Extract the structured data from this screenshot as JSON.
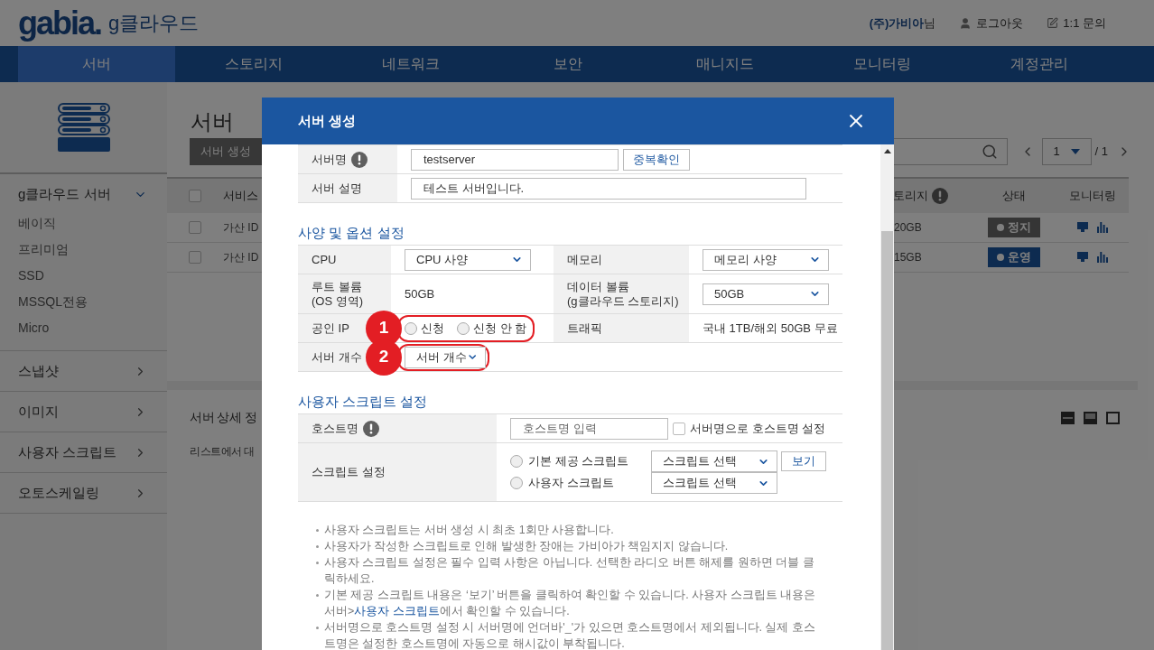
{
  "header": {
    "logo": "gabia.",
    "product": "g클라우드",
    "user": "**(주)가비아**님",
    "links": [
      {
        "kind": "logout",
        "label": "로그아웃"
      },
      {
        "kind": "inquiry",
        "label": "1:1 문의"
      }
    ]
  },
  "nav": [
    {
      "label": "서버",
      "selected": true
    },
    {
      "label": "스토리지",
      "selected": false
    },
    {
      "label": "네트워크",
      "selected": false
    },
    {
      "label": "보안",
      "selected": false
    },
    {
      "label": "매니지드",
      "selected": false
    },
    {
      "label": "모니터링",
      "selected": false
    },
    {
      "label": "계정관리",
      "selected": false
    }
  ],
  "sidebar": {
    "groups": [
      {
        "label": "g클라우드 서버",
        "expanded": true,
        "children": [
          {
            "label": "베이직"
          },
          {
            "label": "프리미엄"
          },
          {
            "label": "SSD"
          },
          {
            "label": "MSSQL전용"
          },
          {
            "label": "Micro"
          }
        ]
      },
      {
        "label": "스냅샷",
        "expanded": false
      },
      {
        "label": "이미지",
        "expanded": false
      },
      {
        "label": "사용자 스크립트",
        "expanded": false
      },
      {
        "label": "오토스케일링",
        "expanded": false
      }
    ]
  },
  "page": {
    "title": "서버",
    "create_button": "서버 생성",
    "pagination": {
      "page": "1",
      "total": "/ 1"
    }
  },
  "table": {
    "header_checked": false,
    "columns": [
      {
        "label": "서비스",
        "info": false
      },
      {
        "label": "토리지",
        "info": true
      },
      {
        "label": "상태",
        "info": false
      },
      {
        "label": "모니터링",
        "info": false
      }
    ],
    "rows": [
      {
        "checked": false,
        "service": "가산 ID",
        "storage": "20GB",
        "status": "정지",
        "running": false
      },
      {
        "checked": false,
        "service": "가산 ID",
        "storage": "15GB",
        "status": "운영",
        "running": true
      }
    ]
  },
  "detail": {
    "title": "서버 상세 정",
    "hint": "리스트에서 대"
  },
  "modal": {
    "title": "서버 생성",
    "basic": {
      "name": {
        "label": "서버명",
        "value": "testserver",
        "button": "중복확인"
      },
      "description": {
        "label": "서버 설명",
        "value": "테스트 서버입니다."
      }
    },
    "spec_title": "사양 및 옵션 설정",
    "spec_rows": [
      [
        {
          "kind": "label",
          "lines": [
            "CPU"
          ]
        },
        {
          "kind": "select",
          "value": "CPU 사양"
        },
        {
          "kind": "label",
          "lines": [
            "메모리"
          ]
        },
        {
          "kind": "select",
          "value": "메모리 사양"
        }
      ],
      [
        {
          "kind": "label",
          "lines": [
            "루트 볼륨",
            "(OS 영역)"
          ]
        },
        {
          "kind": "text",
          "text": "50GB"
        },
        {
          "kind": "label",
          "lines": [
            "데이터 볼륨",
            "(g클라우드 스토리지)"
          ]
        },
        {
          "kind": "select",
          "value": "50GB"
        }
      ],
      [
        {
          "kind": "label",
          "lines": [
            "공인 IP"
          ]
        },
        {
          "kind": "radios",
          "callout": "1",
          "options": [
            {
              "label": "신청",
              "selected": false
            },
            {
              "label": "신청 안 함",
              "selected": false
            }
          ]
        },
        {
          "kind": "label",
          "lines": [
            "트래픽"
          ]
        },
        {
          "kind": "text",
          "text": "국내 1TB/해외 50GB 무료"
        }
      ],
      [
        {
          "kind": "label",
          "lines": [
            "서버 개수"
          ]
        },
        {
          "kind": "select",
          "value": "서버 개수",
          "callout": "2"
        }
      ]
    ],
    "script_title": "사용자 스크립트 설정",
    "hostname": {
      "label": "호스트명",
      "placeholder": "호스트명 입력",
      "checkbox": {
        "label": "서버명으로 호스트명 설정",
        "checked": false
      }
    },
    "script": {
      "label": "스크립트 설정",
      "options": [
        {
          "label": "기본 제공 스크립트",
          "selected": false,
          "select": "스크립트 선택",
          "button": "보기"
        },
        {
          "label": "사용자 스크립트",
          "selected": false,
          "select": "스크립트 선택"
        }
      ]
    },
    "notes": [
      {
        "text": "사용자 스크립트는 서버 생성 시 최초 1회만 사용합니다."
      },
      {
        "text": "사용자가 작성한 스크립트로 인해 발생한 장애는 가비아가 책임지지 않습니다."
      },
      {
        "text": "사용자 스크립트 설정은 필수 입력 사항은 아닙니다. 선택한 라디오 버튼 해제를 원하면 더블 클릭하세요."
      },
      {
        "text": "기본 제공 스크립트 내용은 ‘보기’ 버튼을 클릭하여 확인할 수 있습니다. 사용자 스크립트 내용은 서버>",
        "link": "사용자 스크립트",
        "after": "에서 확인할 수 있습니다."
      },
      {
        "text": "서버명으로 호스트명 설정 시 서버명에 언더바'_'가 있으면 호스트명에서 제외됩니다. 실제 호스트명은 설정한 호스트명에 자동으로 해시값이 부착됩니다."
      }
    ]
  }
}
